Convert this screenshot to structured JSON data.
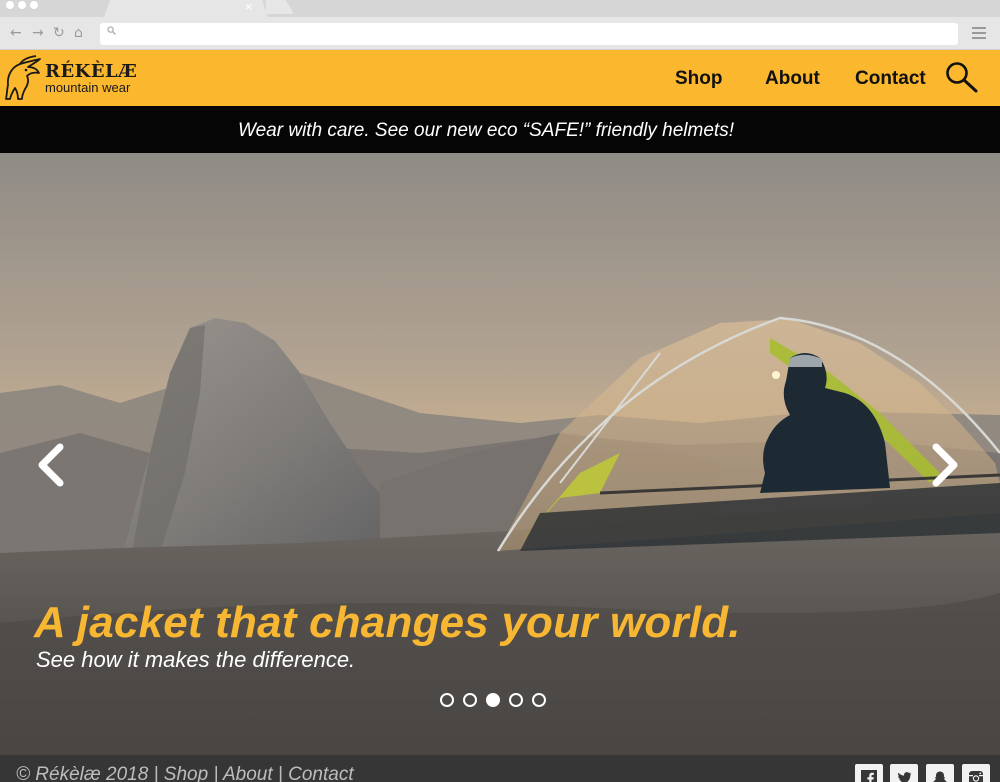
{
  "browser": {
    "tab_close_label": "×",
    "nav_icons": [
      "back-arrow-icon",
      "forward-arrow-icon",
      "reload-icon",
      "home-icon"
    ],
    "back_glyph": "←",
    "forward_glyph": "→",
    "reload_glyph": "↻",
    "home_glyph": "⌂",
    "address_value": ""
  },
  "header": {
    "logo_name": "RÉKÈLÆ",
    "logo_tagline": "mountain wear",
    "nav": [
      {
        "label": "Shop"
      },
      {
        "label": "About"
      },
      {
        "label": "Contact"
      }
    ],
    "search_icon": "search-icon"
  },
  "promo": {
    "text": "Wear with care. See our new eco “SAFE!” friendly helmets!"
  },
  "hero": {
    "title": "A jacket that changes your world.",
    "subtitle": "See how it makes the difference.",
    "slide_count": 5,
    "active_slide": 3,
    "prev_icon": "chevron-left-icon",
    "next_icon": "chevron-right-icon"
  },
  "footer": {
    "copyright": "© Rékèlæ 2018",
    "separator": " | ",
    "links": [
      "Shop",
      "About",
      "Contact"
    ],
    "social_icons": [
      "facebook-icon",
      "twitter-icon",
      "snapchat-icon",
      "instagram-icon"
    ]
  },
  "colors": {
    "brand_yellow": "#fbb72d",
    "headline_yellow": "#f7b733",
    "banner_black": "#050505",
    "footer_gray": "#363636"
  }
}
